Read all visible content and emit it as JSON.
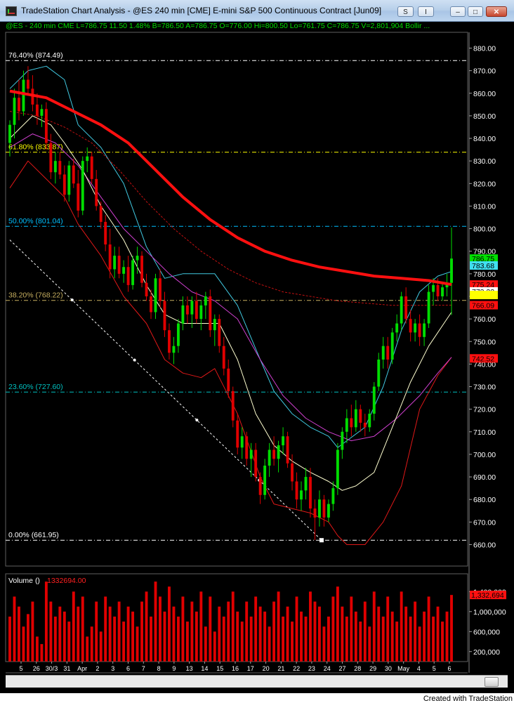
{
  "window": {
    "title": "TradeStation Chart Analysis - @ES  240 min  [CME] E-mini S&P 500 Continuous Contract [Jun09]",
    "controls": {
      "s_label": "S",
      "i_label": "I",
      "minimize": "–",
      "maximize": "□",
      "close": "✕"
    }
  },
  "infobar": {
    "text": "@ES - 240 min  CME  L=786.75  11.50  1.48%  B=786.50  A=786.75  O=776.00  Hi=800.50  Lo=761.75  C=786.75  V=2,801,904  Bollir ..."
  },
  "fib": [
    {
      "label": "76.40% (874.49)",
      "value": 874.49,
      "color": "#ffffff"
    },
    {
      "label": "61.80% (833.87)",
      "value": 833.87,
      "color": "#ffff00"
    },
    {
      "label": "50.00% (801.04)",
      "value": 801.04,
      "color": "#00c0ff"
    },
    {
      "label": "38.20% (768.22)",
      "value": 768.22,
      "color": "#c8b060"
    },
    {
      "label": "23.60% (727.60)",
      "value": 727.6,
      "color": "#00c0c0"
    },
    {
      "label": "0.00% (661.95)",
      "value": 661.95,
      "color": "#ffffff"
    }
  ],
  "price_axis": {
    "ticks": [
      "880.00",
      "870.00",
      "860.00",
      "850.00",
      "840.00",
      "830.00",
      "820.00",
      "810.00",
      "800.00",
      "790.00",
      "780.00",
      "770.00",
      "760.00",
      "750.00",
      "740.00",
      "730.00",
      "720.00",
      "710.00",
      "700.00",
      "690.00",
      "680.00",
      "670.00",
      "660.00"
    ],
    "tags": [
      {
        "label": "786.75",
        "value": 786.75,
        "bg": "#00e000",
        "fg": "#000000"
      },
      {
        "label": "783.68",
        "value": 783.68,
        "bg": "#40e0f0",
        "fg": "#000000"
      },
      {
        "label": "775.24",
        "value": 775.24,
        "bg": "#ff1010",
        "fg": "#000000"
      },
      {
        "label": "773.22",
        "value": 772.2,
        "bg": "#ffffff",
        "fg": "#000000"
      },
      {
        "label": "",
        "value": 770.6,
        "bg": "#ffff00",
        "fg": "#000000"
      },
      {
        "label": "766.09",
        "value": 766.09,
        "bg": "#ff1010",
        "fg": "#000000"
      },
      {
        "label": "742.52",
        "value": 742.52,
        "bg": "#ff1010",
        "fg": "#000000"
      }
    ]
  },
  "volume": {
    "label": "Volume ()",
    "value": "1332694.00",
    "ticks": [
      "1,400,000",
      "1,000,000",
      "600,000",
      "200,000"
    ],
    "tag": "1,332,694"
  },
  "chart_data": {
    "type": "candlestick",
    "ylim": [
      650.5,
      887
    ],
    "volume_ylim": [
      0,
      1700000
    ],
    "candles": [
      {
        "o": 838,
        "h": 848,
        "l": 832,
        "c": 846,
        "v": 900000
      },
      {
        "o": 846,
        "h": 862,
        "l": 840,
        "c": 858,
        "v": 1300000
      },
      {
        "o": 858,
        "h": 866,
        "l": 848,
        "c": 852,
        "v": 1100000
      },
      {
        "o": 852,
        "h": 870,
        "l": 850,
        "c": 866,
        "v": 700000
      },
      {
        "o": 866,
        "h": 872,
        "l": 860,
        "c": 862,
        "v": 950000
      },
      {
        "o": 862,
        "h": 868,
        "l": 852,
        "c": 855,
        "v": 1200000
      },
      {
        "o": 855,
        "h": 860,
        "l": 846,
        "c": 850,
        "v": 500000
      },
      {
        "o": 850,
        "h": 855,
        "l": 845,
        "c": 853,
        "v": 350000
      },
      {
        "o": 853,
        "h": 856,
        "l": 835,
        "c": 838,
        "v": 1600000
      },
      {
        "o": 838,
        "h": 842,
        "l": 822,
        "c": 825,
        "v": 1200000
      },
      {
        "o": 825,
        "h": 834,
        "l": 820,
        "c": 830,
        "v": 900000
      },
      {
        "o": 830,
        "h": 834,
        "l": 822,
        "c": 824,
        "v": 1100000
      },
      {
        "o": 824,
        "h": 828,
        "l": 812,
        "c": 815,
        "v": 1000000
      },
      {
        "o": 815,
        "h": 830,
        "l": 812,
        "c": 828,
        "v": 800000
      },
      {
        "o": 828,
        "h": 831,
        "l": 818,
        "c": 820,
        "v": 1400000
      },
      {
        "o": 820,
        "h": 826,
        "l": 805,
        "c": 808,
        "v": 1100000
      },
      {
        "o": 808,
        "h": 832,
        "l": 806,
        "c": 830,
        "v": 1300000
      },
      {
        "o": 830,
        "h": 836,
        "l": 825,
        "c": 832,
        "v": 500000
      },
      {
        "o": 832,
        "h": 834,
        "l": 820,
        "c": 822,
        "v": 700000
      },
      {
        "o": 822,
        "h": 826,
        "l": 808,
        "c": 810,
        "v": 1200000
      },
      {
        "o": 810,
        "h": 812,
        "l": 800,
        "c": 803,
        "v": 600000
      },
      {
        "o": 803,
        "h": 806,
        "l": 790,
        "c": 793,
        "v": 1300000
      },
      {
        "o": 793,
        "h": 800,
        "l": 778,
        "c": 782,
        "v": 1100000
      },
      {
        "o": 782,
        "h": 792,
        "l": 778,
        "c": 788,
        "v": 900000
      },
      {
        "o": 788,
        "h": 792,
        "l": 778,
        "c": 780,
        "v": 1200000
      },
      {
        "o": 780,
        "h": 786,
        "l": 776,
        "c": 783,
        "v": 800000
      },
      {
        "o": 783,
        "h": 788,
        "l": 772,
        "c": 775,
        "v": 1100000
      },
      {
        "o": 775,
        "h": 788,
        "l": 773,
        "c": 786,
        "v": 1000000
      },
      {
        "o": 786,
        "h": 792,
        "l": 780,
        "c": 788,
        "v": 700000
      },
      {
        "o": 788,
        "h": 790,
        "l": 774,
        "c": 776,
        "v": 1200000
      },
      {
        "o": 776,
        "h": 780,
        "l": 768,
        "c": 770,
        "v": 1400000
      },
      {
        "o": 770,
        "h": 773,
        "l": 760,
        "c": 763,
        "v": 900000
      },
      {
        "o": 763,
        "h": 780,
        "l": 760,
        "c": 778,
        "v": 1600000
      },
      {
        "o": 778,
        "h": 782,
        "l": 765,
        "c": 768,
        "v": 1300000
      },
      {
        "o": 768,
        "h": 772,
        "l": 752,
        "c": 755,
        "v": 1000000
      },
      {
        "o": 755,
        "h": 758,
        "l": 742,
        "c": 745,
        "v": 1500000
      },
      {
        "o": 745,
        "h": 752,
        "l": 740,
        "c": 748,
        "v": 1100000
      },
      {
        "o": 748,
        "h": 760,
        "l": 745,
        "c": 758,
        "v": 900000
      },
      {
        "o": 758,
        "h": 770,
        "l": 755,
        "c": 766,
        "v": 1300000
      },
      {
        "o": 766,
        "h": 770,
        "l": 758,
        "c": 762,
        "v": 800000
      },
      {
        "o": 762,
        "h": 770,
        "l": 756,
        "c": 768,
        "v": 1200000
      },
      {
        "o": 768,
        "h": 772,
        "l": 758,
        "c": 760,
        "v": 1000000
      },
      {
        "o": 760,
        "h": 768,
        "l": 755,
        "c": 766,
        "v": 1400000
      },
      {
        "o": 766,
        "h": 772,
        "l": 760,
        "c": 770,
        "v": 700000
      },
      {
        "o": 770,
        "h": 773,
        "l": 752,
        "c": 755,
        "v": 1300000
      },
      {
        "o": 755,
        "h": 762,
        "l": 748,
        "c": 760,
        "v": 600000
      },
      {
        "o": 760,
        "h": 762,
        "l": 745,
        "c": 748,
        "v": 1100000
      },
      {
        "o": 748,
        "h": 752,
        "l": 735,
        "c": 738,
        "v": 900000
      },
      {
        "o": 738,
        "h": 742,
        "l": 725,
        "c": 728,
        "v": 1200000
      },
      {
        "o": 728,
        "h": 730,
        "l": 712,
        "c": 715,
        "v": 1400000
      },
      {
        "o": 715,
        "h": 718,
        "l": 700,
        "c": 703,
        "v": 1000000
      },
      {
        "o": 703,
        "h": 712,
        "l": 698,
        "c": 708,
        "v": 800000
      },
      {
        "o": 708,
        "h": 710,
        "l": 695,
        "c": 698,
        "v": 1200000
      },
      {
        "o": 698,
        "h": 705,
        "l": 690,
        "c": 702,
        "v": 900000
      },
      {
        "o": 702,
        "h": 705,
        "l": 688,
        "c": 690,
        "v": 1300000
      },
      {
        "o": 690,
        "h": 692,
        "l": 678,
        "c": 682,
        "v": 1100000
      },
      {
        "o": 682,
        "h": 698,
        "l": 680,
        "c": 695,
        "v": 1000000
      },
      {
        "o": 695,
        "h": 705,
        "l": 690,
        "c": 702,
        "v": 700000
      },
      {
        "o": 702,
        "h": 708,
        "l": 695,
        "c": 698,
        "v": 1200000
      },
      {
        "o": 698,
        "h": 706,
        "l": 692,
        "c": 704,
        "v": 1400000
      },
      {
        "o": 704,
        "h": 712,
        "l": 700,
        "c": 708,
        "v": 900000
      },
      {
        "o": 708,
        "h": 710,
        "l": 694,
        "c": 696,
        "v": 1100000
      },
      {
        "o": 696,
        "h": 700,
        "l": 684,
        "c": 688,
        "v": 800000
      },
      {
        "o": 688,
        "h": 692,
        "l": 676,
        "c": 680,
        "v": 1300000
      },
      {
        "o": 680,
        "h": 688,
        "l": 675,
        "c": 684,
        "v": 1000000
      },
      {
        "o": 684,
        "h": 694,
        "l": 680,
        "c": 690,
        "v": 900000
      },
      {
        "o": 690,
        "h": 694,
        "l": 672,
        "c": 676,
        "v": 1400000
      },
      {
        "o": 676,
        "h": 680,
        "l": 662,
        "c": 672,
        "v": 1200000
      },
      {
        "o": 672,
        "h": 684,
        "l": 668,
        "c": 680,
        "v": 1100000
      },
      {
        "o": 680,
        "h": 682,
        "l": 668,
        "c": 672,
        "v": 700000
      },
      {
        "o": 672,
        "h": 680,
        "l": 670,
        "c": 678,
        "v": 900000
      },
      {
        "o": 678,
        "h": 688,
        "l": 675,
        "c": 685,
        "v": 1300000
      },
      {
        "o": 685,
        "h": 705,
        "l": 682,
        "c": 702,
        "v": 1500000
      },
      {
        "o": 702,
        "h": 712,
        "l": 698,
        "c": 710,
        "v": 1100000
      },
      {
        "o": 710,
        "h": 720,
        "l": 705,
        "c": 716,
        "v": 900000
      },
      {
        "o": 716,
        "h": 722,
        "l": 708,
        "c": 712,
        "v": 1300000
      },
      {
        "o": 712,
        "h": 724,
        "l": 710,
        "c": 720,
        "v": 1000000
      },
      {
        "o": 720,
        "h": 722,
        "l": 710,
        "c": 714,
        "v": 800000
      },
      {
        "o": 714,
        "h": 718,
        "l": 708,
        "c": 712,
        "v": 1200000
      },
      {
        "o": 712,
        "h": 720,
        "l": 710,
        "c": 718,
        "v": 700000
      },
      {
        "o": 718,
        "h": 732,
        "l": 715,
        "c": 730,
        "v": 1400000
      },
      {
        "o": 730,
        "h": 745,
        "l": 728,
        "c": 742,
        "v": 1100000
      },
      {
        "o": 742,
        "h": 752,
        "l": 738,
        "c": 748,
        "v": 900000
      },
      {
        "o": 748,
        "h": 752,
        "l": 738,
        "c": 742,
        "v": 1300000
      },
      {
        "o": 742,
        "h": 756,
        "l": 740,
        "c": 754,
        "v": 1000000
      },
      {
        "o": 754,
        "h": 762,
        "l": 750,
        "c": 758,
        "v": 800000
      },
      {
        "o": 758,
        "h": 772,
        "l": 755,
        "c": 770,
        "v": 1400000
      },
      {
        "o": 770,
        "h": 774,
        "l": 758,
        "c": 760,
        "v": 1100000
      },
      {
        "o": 760,
        "h": 764,
        "l": 750,
        "c": 754,
        "v": 900000
      },
      {
        "o": 754,
        "h": 760,
        "l": 750,
        "c": 758,
        "v": 1200000
      },
      {
        "o": 758,
        "h": 762,
        "l": 748,
        "c": 752,
        "v": 700000
      },
      {
        "o": 752,
        "h": 760,
        "l": 748,
        "c": 758,
        "v": 1000000
      },
      {
        "o": 758,
        "h": 775,
        "l": 756,
        "c": 772,
        "v": 1300000
      },
      {
        "o": 772,
        "h": 778,
        "l": 766,
        "c": 775,
        "v": 900000
      },
      {
        "o": 775,
        "h": 778,
        "l": 768,
        "c": 770,
        "v": 1100000
      },
      {
        "o": 770,
        "h": 776,
        "l": 768,
        "c": 774,
        "v": 800000
      },
      {
        "o": 774,
        "h": 780,
        "l": 770,
        "c": 776,
        "v": 1000000
      },
      {
        "o": 776,
        "h": 800.5,
        "l": 761.75,
        "c": 786.75,
        "v": 1332694
      }
    ],
    "bb_upper": [
      [
        0,
        862
      ],
      [
        4,
        870
      ],
      [
        8,
        872
      ],
      [
        12,
        866
      ],
      [
        15,
        846
      ],
      [
        20,
        836
      ],
      [
        25,
        820
      ],
      [
        30,
        792
      ],
      [
        34,
        778
      ],
      [
        38,
        780
      ],
      [
        42,
        780
      ],
      [
        45,
        780
      ],
      [
        50,
        766
      ],
      [
        55,
        742
      ],
      [
        58,
        728
      ],
      [
        62,
        718
      ],
      [
        66,
        712
      ],
      [
        70,
        708
      ],
      [
        72,
        703
      ],
      [
        74,
        706
      ],
      [
        78,
        712
      ],
      [
        82,
        730
      ],
      [
        86,
        755
      ],
      [
        90,
        772
      ],
      [
        94,
        779
      ],
      [
        97,
        781
      ]
    ],
    "bb_lower": [
      [
        0,
        818
      ],
      [
        4,
        830
      ],
      [
        8,
        822
      ],
      [
        12,
        814
      ],
      [
        15,
        802
      ],
      [
        20,
        788
      ],
      [
        25,
        770
      ],
      [
        30,
        758
      ],
      [
        34,
        742
      ],
      [
        38,
        736
      ],
      [
        42,
        734
      ],
      [
        45,
        738
      ],
      [
        50,
        718
      ],
      [
        55,
        690
      ],
      [
        58,
        678
      ],
      [
        62,
        676
      ],
      [
        66,
        674
      ],
      [
        70,
        670
      ],
      [
        72,
        664
      ],
      [
        74,
        660
      ],
      [
        78,
        660
      ],
      [
        82,
        670
      ],
      [
        86,
        686
      ],
      [
        90,
        720
      ],
      [
        94,
        735
      ],
      [
        97,
        743
      ]
    ],
    "bb_mid": [
      [
        0,
        840
      ],
      [
        5,
        850
      ],
      [
        9,
        846
      ],
      [
        12,
        838
      ],
      [
        16,
        826
      ],
      [
        20,
        810
      ],
      [
        25,
        795
      ],
      [
        30,
        775
      ],
      [
        34,
        762
      ],
      [
        38,
        758
      ],
      [
        42,
        758
      ],
      [
        46,
        758
      ],
      [
        50,
        742
      ],
      [
        54,
        718
      ],
      [
        58,
        704
      ],
      [
        62,
        697
      ],
      [
        66,
        692
      ],
      [
        70,
        688
      ],
      [
        73,
        684
      ],
      [
        76,
        686
      ],
      [
        80,
        692
      ],
      [
        84,
        712
      ],
      [
        88,
        732
      ],
      [
        92,
        748
      ],
      [
        96,
        760
      ],
      [
        97,
        763
      ]
    ],
    "ma_magenta": [
      [
        0,
        836
      ],
      [
        5,
        842
      ],
      [
        10,
        838
      ],
      [
        15,
        828
      ],
      [
        20,
        814
      ],
      [
        25,
        800
      ],
      [
        30,
        790
      ],
      [
        35,
        780
      ],
      [
        40,
        772
      ],
      [
        45,
        768
      ],
      [
        50,
        760
      ],
      [
        55,
        742
      ],
      [
        60,
        726
      ],
      [
        65,
        716
      ],
      [
        70,
        710
      ],
      [
        75,
        706
      ],
      [
        80,
        708
      ],
      [
        85,
        716
      ],
      [
        90,
        726
      ],
      [
        94,
        736
      ],
      [
        97,
        743
      ]
    ],
    "ma_red_thick": [
      [
        0,
        861
      ],
      [
        8,
        858
      ],
      [
        14,
        852
      ],
      [
        20,
        846
      ],
      [
        26,
        838
      ],
      [
        32,
        826
      ],
      [
        38,
        814
      ],
      [
        44,
        804
      ],
      [
        50,
        796
      ],
      [
        56,
        790
      ],
      [
        62,
        786
      ],
      [
        68,
        783
      ],
      [
        74,
        781
      ],
      [
        80,
        779
      ],
      [
        86,
        778
      ],
      [
        92,
        777
      ],
      [
        97,
        775.24
      ]
    ],
    "ma_red_dashed": [
      [
        0,
        852
      ],
      [
        6,
        850
      ],
      [
        12,
        845
      ],
      [
        18,
        838
      ],
      [
        24,
        826
      ],
      [
        30,
        812
      ],
      [
        36,
        800
      ],
      [
        42,
        790
      ],
      [
        48,
        782
      ],
      [
        54,
        776
      ],
      [
        60,
        772
      ],
      [
        66,
        770
      ],
      [
        72,
        768
      ],
      [
        78,
        767
      ],
      [
        84,
        766
      ],
      [
        90,
        766
      ],
      [
        97,
        766.09
      ]
    ],
    "trendline": {
      "start": [
        0,
        795
      ],
      "end": [
        68,
        661.95
      ]
    },
    "time_labels": [
      "5",
      "26",
      "30/3",
      "31",
      "Apr",
      "2",
      "3",
      "6",
      "7",
      "8",
      "9",
      "13",
      "14",
      "15",
      "16",
      "17",
      "20",
      "21",
      "22",
      "23",
      "24",
      "27",
      "28",
      "29",
      "30",
      "May",
      "4",
      "5",
      "6"
    ]
  },
  "footer": {
    "credit": "Created with TradeStation"
  },
  "colors": {
    "up": "#00dd00",
    "down": "#e00000",
    "bb_band": "#40c8e0",
    "bb_lower": "#e01818",
    "mid": "#ffffc8",
    "magenta": "#d040d0",
    "ma_red": "#ff1010"
  }
}
